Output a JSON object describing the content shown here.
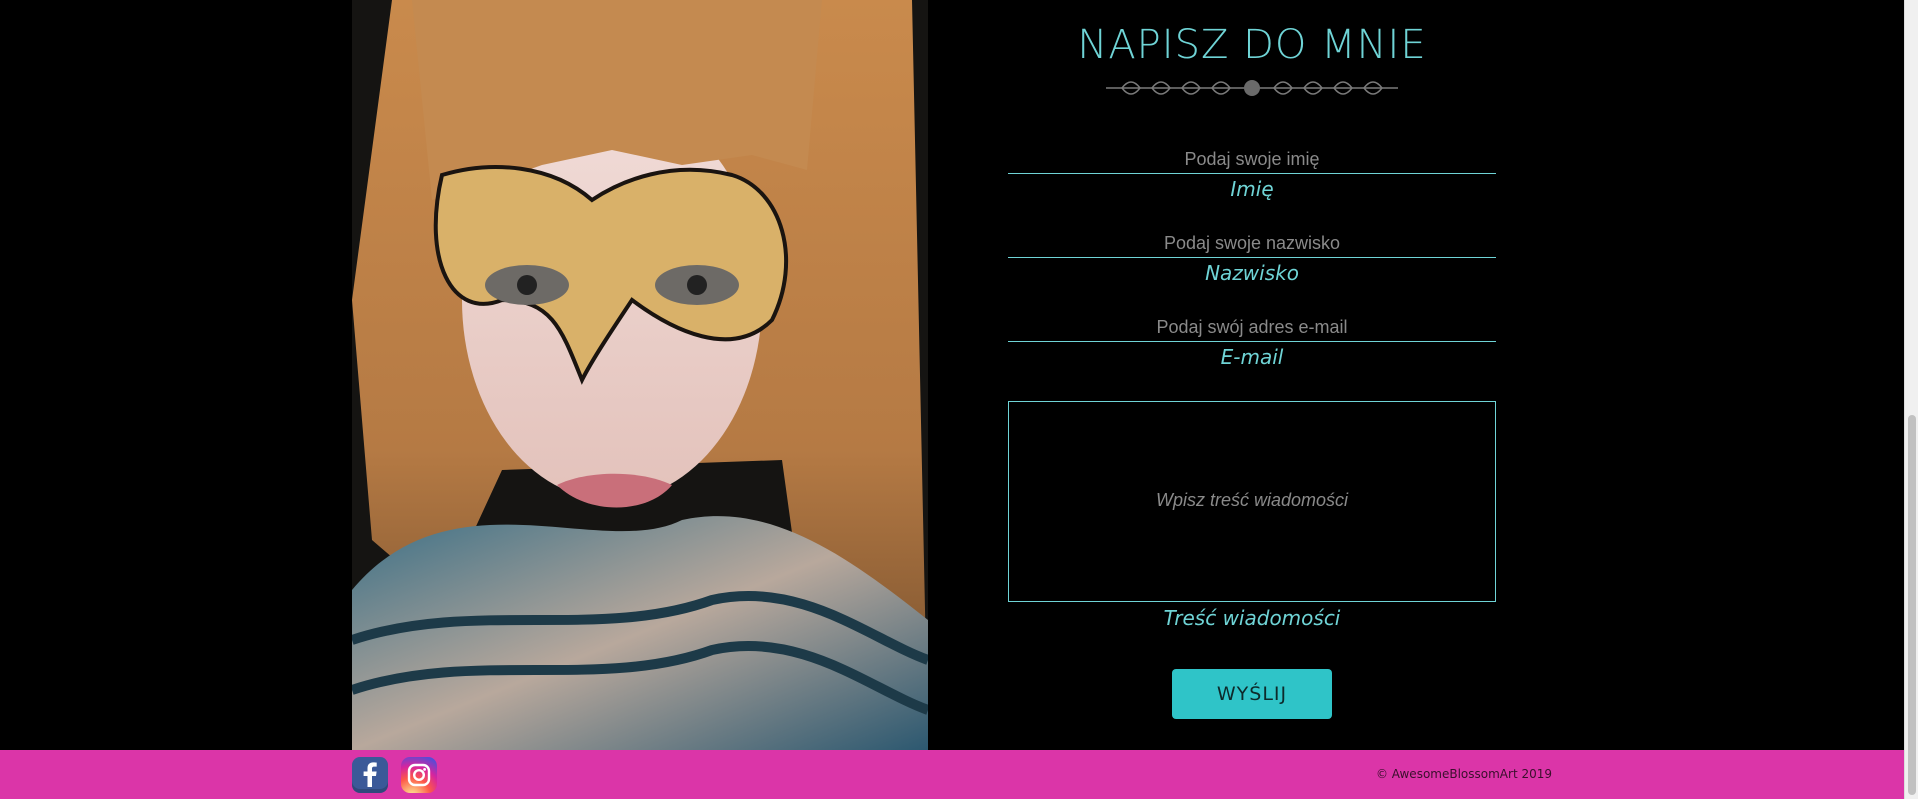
{
  "contact": {
    "title": "NAPISZ DO MNIE",
    "name_placeholder": "Podaj swoje imię",
    "name_label": "Imię",
    "surname_placeholder": "Podaj swoje nazwisko",
    "surname_label": "Nazwisko",
    "email_placeholder": "Podaj swój adres e-mail",
    "email_label": "E-mail",
    "message_placeholder": "Wpisz treść wiadomości",
    "message_label": "Treść wiadomości",
    "submit_label": "WYŚLIJ"
  },
  "footer": {
    "facebook_icon": "facebook-icon",
    "instagram_icon": "instagram-icon",
    "copyright": "© AwesomeBlossomArt 2019"
  },
  "colors": {
    "accent": "#6fd4d6",
    "button": "#2fc4c8",
    "footer": "#db35a8",
    "background": "#000000"
  }
}
